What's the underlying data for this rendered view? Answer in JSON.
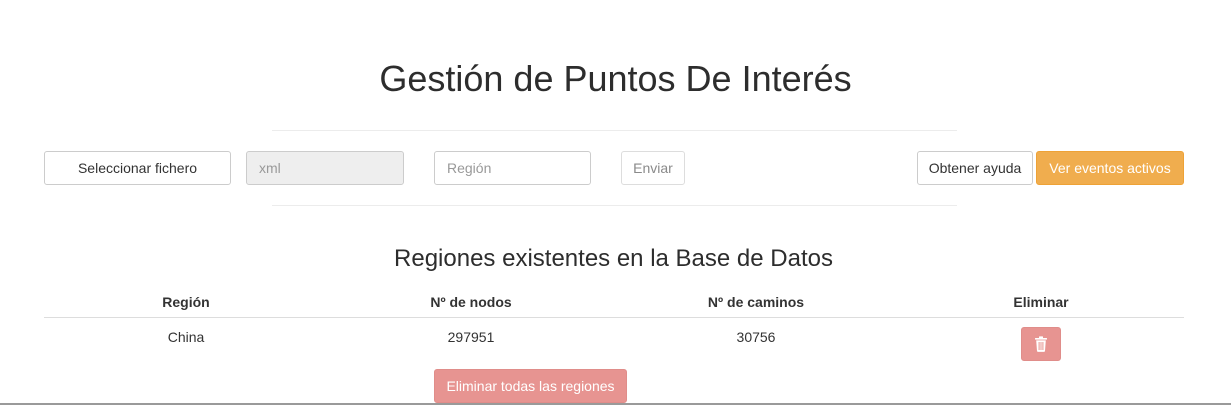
{
  "header": {
    "title": "Gestión de Puntos De Interés"
  },
  "upload_form": {
    "file_button_label": "Seleccionar fichero",
    "file_field_placeholder": "xml",
    "region_placeholder": "Región",
    "send_label": "Enviar"
  },
  "actions": {
    "help_label": "Obtener ayuda",
    "events_label": "Ver eventos activos"
  },
  "regions_section": {
    "title": "Regiones existentes en la Base de Datos",
    "columns": [
      "Región",
      "Nº de nodos",
      "Nº de caminos",
      "Eliminar"
    ],
    "rows": [
      {
        "region": "China",
        "nodes": "297951",
        "ways": "30756"
      }
    ],
    "delete_all_label": "Eliminar todas las regiones"
  },
  "icons": {
    "delete_row": "trash-icon"
  },
  "colors": {
    "warning_button": "#f0ad4e",
    "danger_button_disabled": "#e79491"
  }
}
